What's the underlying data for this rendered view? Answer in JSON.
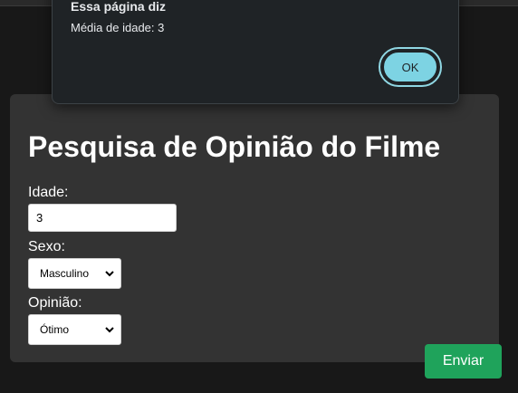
{
  "dialog": {
    "title": "Essa página diz",
    "message": "Média de idade: 3",
    "ok_label": "OK"
  },
  "form": {
    "title": "Pesquisa de Opinião do Filme",
    "age": {
      "label": "Idade:",
      "value": "3"
    },
    "sex": {
      "label": "Sexo:",
      "selected": "Masculino"
    },
    "opinion": {
      "label": "Opinião:",
      "selected": "Ótimo"
    },
    "submit_label": "Enviar"
  },
  "icons": {
    "select_arrow": "chevron-down-icon"
  },
  "colors": {
    "page_background": "#181818",
    "card_background": "#333333",
    "submit_button": "#1fa35b",
    "dialog_background": "#1f2326",
    "dialog_ok_button": "#7dd3e3"
  }
}
